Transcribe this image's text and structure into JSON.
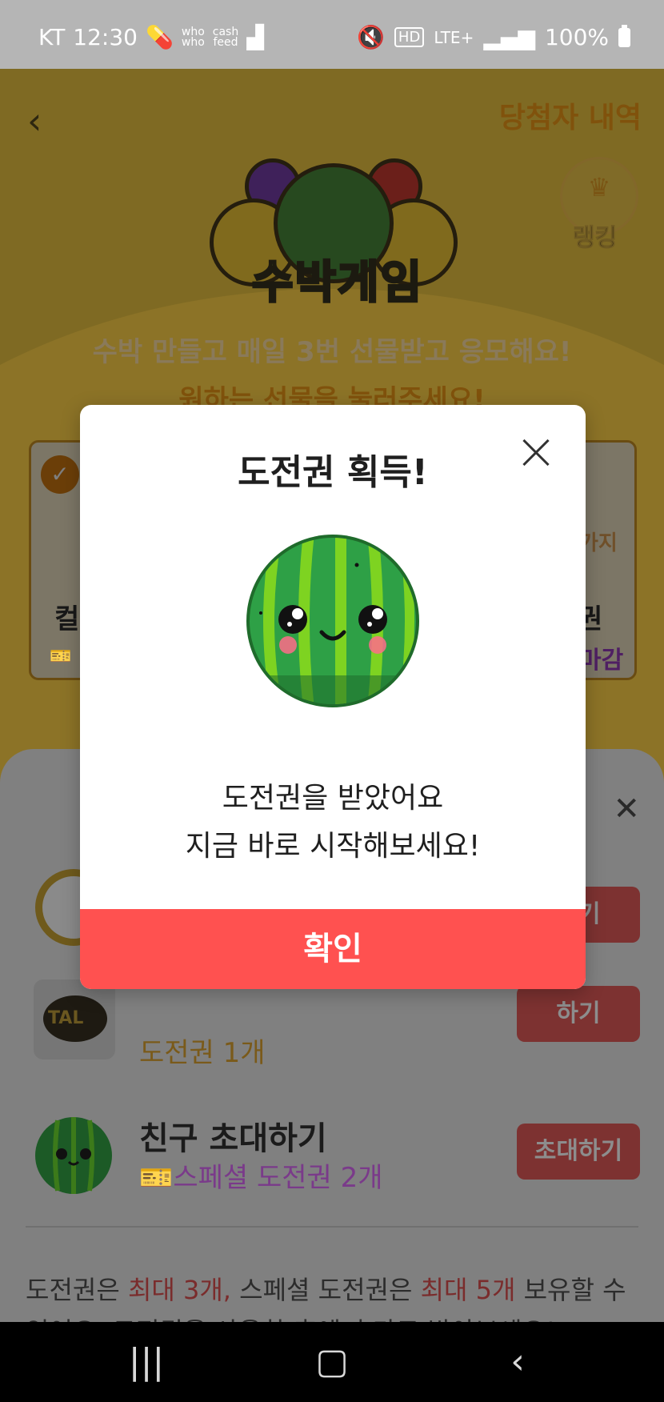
{
  "status_bar": {
    "carrier": "KT",
    "time": "12:30",
    "app1_top": "who",
    "app1_bottom": "who",
    "app2_top": "cash",
    "app2_bottom": "feed",
    "network_hd": "HD",
    "network": "LTE+",
    "battery": "100%"
  },
  "game_header": {
    "back_icon": "chevron-left-icon",
    "winners_link": "당첨자 내역",
    "ranking_label": "랭킹",
    "logo_text": "수박게임",
    "promo_line1": "수박 만들고 매일 3번 선물받고 응모해요!",
    "promo_line2": "원하는 선물을 눌러주세요!"
  },
  "prize_cards": {
    "left_text": "컬",
    "right_badge": "가지",
    "right_text": "권",
    "right_status": "마감"
  },
  "sheet": {
    "rows": [
      {
        "title": "",
        "sub": "",
        "button": "받기"
      },
      {
        "title": "",
        "sub": "도전권 1개",
        "button": "하기",
        "thumb_text": "TAL"
      },
      {
        "title": "친구 초대하기",
        "sub": "스페셜 도전권 2개",
        "button": "초대하기"
      }
    ],
    "notice_parts": {
      "p1": "도전권은 ",
      "p2": "최대 3개,",
      "p3": " 스페셜 도전권은 ",
      "p4": "최대 5개",
      "p5": " 보유할 수 있어요. 도전권을 사용한 후에 추가로 받아보세요!"
    }
  },
  "modal": {
    "title": "도전권 획득!",
    "message_line1": "도전권을 받았어요",
    "message_line2": "지금 바로 시작해보세요!",
    "confirm": "확인"
  },
  "colors": {
    "accent": "#ff5150",
    "watermelon_green": "#2ea046",
    "watermelon_stripe": "#7ed321"
  }
}
